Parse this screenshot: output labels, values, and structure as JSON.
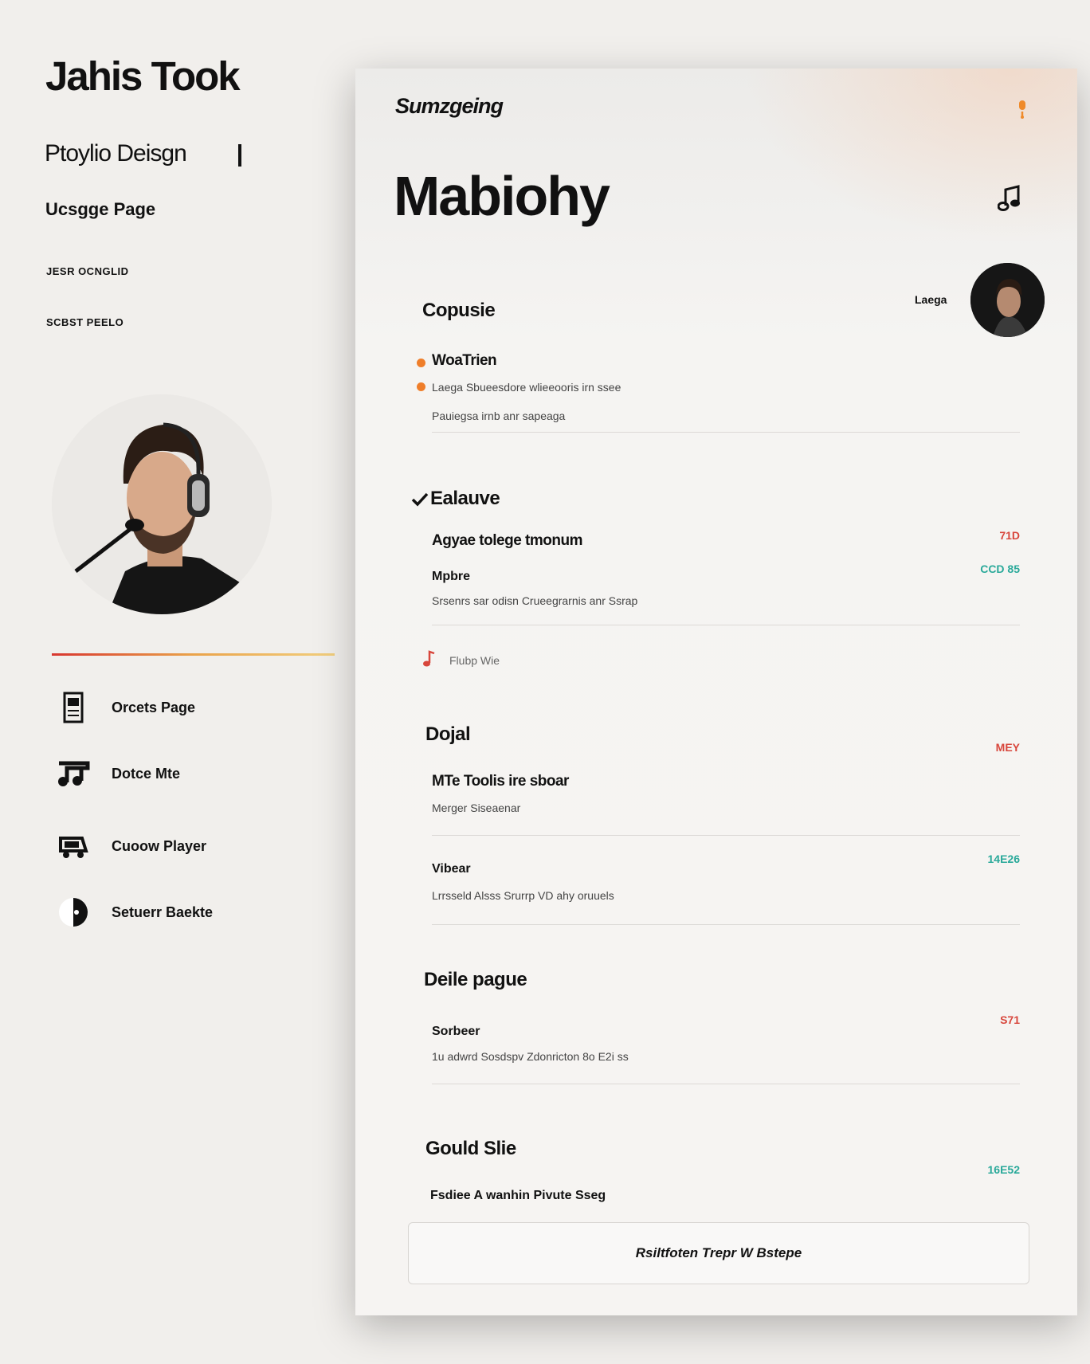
{
  "sidebar": {
    "brand": "Jahis Took",
    "subtitle": "Ptoylio Deisgn",
    "usage": "Ucsgge Page",
    "meta": [
      "JESR OCNGLID",
      "SCBST PEELO"
    ],
    "nav": [
      {
        "label": "Orcets Page",
        "icon": "document-icon"
      },
      {
        "label": "Dotce Mte",
        "icon": "music-icon"
      },
      {
        "label": "Cuoow Player",
        "icon": "player-icon"
      },
      {
        "label": "Setuerr Baekte",
        "icon": "disc-icon"
      }
    ]
  },
  "card": {
    "topline": "Sumzgeing",
    "title": "Mabiohy",
    "profile_label": "Laega",
    "section1": {
      "heading": "Copusie",
      "item_title": "WoaTrien",
      "item_desc": "Laega Sbueesdore wlieeooris irn ssee",
      "item_note": "Pauiegsa irnb anr sapeaga"
    },
    "section2": {
      "heading": "Ealauve",
      "row_title": "Agyae tolege tmonum",
      "tag1": "71D",
      "sub_title": "Mpbre",
      "tag2": "CCD 85",
      "sub_desc": "Srsenrs sar odisn Crueegrarnis anr Ssrap",
      "play_label": "Flubp Wie"
    },
    "section3": {
      "heading": "Dojal",
      "tag1": "MEY",
      "row_title": "MTe Toolis ire sboar",
      "row_desc": "Merger Siseaenar",
      "sub_title": "Vibear",
      "tag2": "14E26",
      "sub_desc": "Lrrsseld Alsss Srurrp VD ahy oruuels"
    },
    "section4": {
      "heading": "Deile pague",
      "tag": "S71",
      "row_title": "Sorbeer",
      "row_desc": "1u adwrd Sosdspv Zdonricton 8o E2i ss"
    },
    "section5": {
      "heading": "Gould Slie",
      "tag": "16E52",
      "row_title": "Fsdiee A wanhin Pivute Sseg"
    },
    "button_label": "Rsiltfoten Trepr W Bstepe"
  },
  "colors": {
    "orange": "#ef7e2a",
    "red": "#d8463c",
    "teal": "#2aa99a",
    "text": "#111111"
  }
}
